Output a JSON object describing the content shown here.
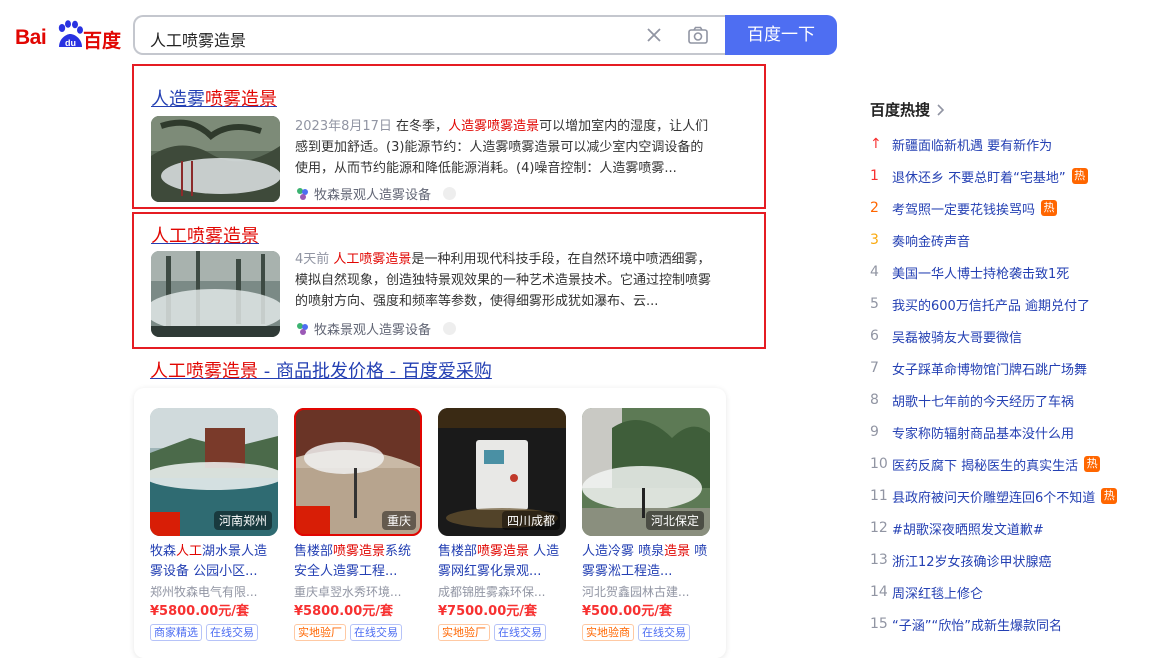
{
  "header": {
    "logo_latin": "Bai",
    "logo_du": "du",
    "logo_cn": "百度",
    "query": "人工喷雾造景",
    "search_button": "百度一下",
    "accent": "#4e6ef2"
  },
  "results": [
    {
      "title_plain": "人造雾",
      "title_hl": "喷雾造景",
      "date": "2023年8月17日",
      "body_pre": "在冬季，",
      "body_hl": "人造雾喷雾造景",
      "body_post": "可以增加室内的湿度，让人们感到更加舒适。(3)能源节约：人造雾喷雾造景可以减少室内空调设备的使用，从而节约能源和降低能源消耗。(4)噪音控制：人造雾喷雾...",
      "source": "牧森景观人造雾设备"
    },
    {
      "title_hl": "人工喷雾造景",
      "date": "4天前",
      "body_hl": "人工喷雾造景",
      "body_post": "是一种利用现代科技手段，在自然环境中喷洒细雾，模拟自然现象，创造独特景观效果的一种艺术造景技术。它通过控制喷雾的喷射方向、强度和频率等参数，使得细雾形成犹如瀑布、云...",
      "source": "牧森景观人造雾设备"
    }
  ],
  "ad": {
    "title_hl": "人工喷雾造景",
    "title_rest": " - 商品批发价格 - 百度爱采购"
  },
  "products": [
    {
      "city": "河南郑州",
      "title_a": "牧森",
      "title_hl1": "人工",
      "title_b": "湖水景人造雾设备 公园小区...",
      "shop": "郑州牧森电气有限...",
      "price": "¥5800.00元/套",
      "tag1": "商家精选",
      "tag2": "在线交易"
    },
    {
      "city": "重庆",
      "title_a": "售楼部",
      "title_hl1": "喷雾造景",
      "title_b": "系统 安全人造雾工程...",
      "shop": "重庆卓翌水秀环境...",
      "price": "¥5800.00元/套",
      "tag1": "实地验厂",
      "tag2": "在线交易"
    },
    {
      "city": "四川成都",
      "title_a": "售楼部",
      "title_hl1": "喷雾造景",
      "title_b": " 人造雾网红雾化景观...",
      "shop": "成都锦胜雾森环保...",
      "price": "¥7500.00元/套",
      "tag1": "实地验厂",
      "tag2": "在线交易"
    },
    {
      "city": "河北保定",
      "title_a": "人造冷雾 喷泉",
      "title_hl1": "造景",
      "title_b": " 喷雾雾淞工程造...",
      "shop": "河北贺鑫园林古建...",
      "price": "¥500.00元/套",
      "tag1": "实地验商",
      "tag2": "在线交易"
    }
  ],
  "hot": {
    "title": "百度热搜",
    "items": [
      {
        "idx": "↑",
        "text": "新疆面临新机遇 要有新作为",
        "badge": ""
      },
      {
        "idx": "1",
        "text": "退休还乡 不要总盯着“宅基地”",
        "badge": "热"
      },
      {
        "idx": "2",
        "text": "考驾照一定要花钱挨骂吗",
        "badge": "热"
      },
      {
        "idx": "3",
        "text": "奏响金砖声音",
        "badge": ""
      },
      {
        "idx": "4",
        "text": "美国一华人博士持枪袭击致1死",
        "badge": ""
      },
      {
        "idx": "5",
        "text": "我买的600万信托产品 逾期兑付了",
        "badge": ""
      },
      {
        "idx": "6",
        "text": "吴磊被骑友大哥要微信",
        "badge": ""
      },
      {
        "idx": "7",
        "text": "女子踩革命博物馆门牌石跳广场舞",
        "badge": ""
      },
      {
        "idx": "8",
        "text": "胡歌十七年前的今天经历了车祸",
        "badge": ""
      },
      {
        "idx": "9",
        "text": "专家称防辐射商品基本没什么用",
        "badge": ""
      },
      {
        "idx": "10",
        "text": "医药反腐下 揭秘医生的真实生活",
        "badge": "热"
      },
      {
        "idx": "11",
        "text": "县政府被问天价雕塑连回6个不知道",
        "badge": "热"
      },
      {
        "idx": "12",
        "text": "#胡歌深夜晒照发文道歉#",
        "badge": ""
      },
      {
        "idx": "13",
        "text": "浙江12岁女孩确诊甲状腺癌",
        "badge": ""
      },
      {
        "idx": "14",
        "text": "周深红毯上修仑",
        "badge": ""
      },
      {
        "idx": "15",
        "text": "“子涵”“欣怡”成新生爆款同名",
        "badge": ""
      }
    ]
  }
}
